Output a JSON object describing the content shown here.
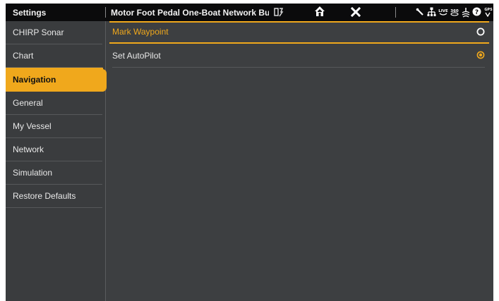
{
  "header": {
    "settings_title": "Settings",
    "window_title": "Motor Foot Pedal One-Boat Network Bu…",
    "icons": [
      "pinned-windows-icon",
      "home-icon",
      "close-icon",
      "satellite-icon",
      "network-icon",
      "live-sonar-icon",
      "360-sonar-icon",
      "depth-icon",
      "help-icon",
      "gps-icon"
    ]
  },
  "sidebar": {
    "items": [
      {
        "label": "CHIRP Sonar"
      },
      {
        "label": "Chart"
      },
      {
        "label": "Navigation",
        "active": true
      },
      {
        "label": "General"
      },
      {
        "label": "My Vessel"
      },
      {
        "label": "Network"
      },
      {
        "label": "Simulation"
      },
      {
        "label": "Restore Defaults"
      }
    ]
  },
  "main": {
    "options": [
      {
        "label": "Mark Waypoint",
        "checked": false
      },
      {
        "label": "Set AutoPilot",
        "checked": true
      }
    ]
  },
  "colors": {
    "accent": "#f0a81c",
    "topbar": "#0b0b0c",
    "panel": "#3d3f41"
  }
}
